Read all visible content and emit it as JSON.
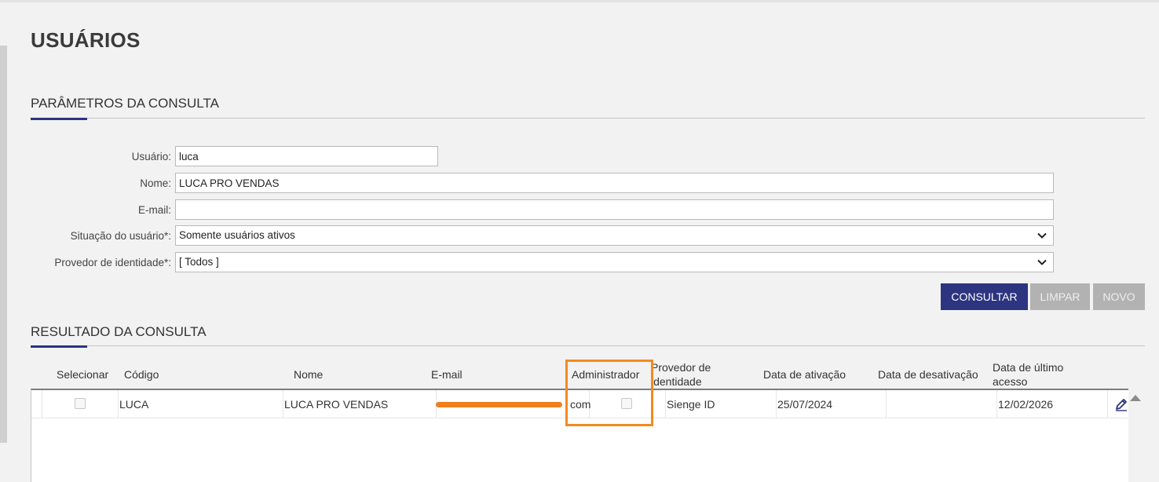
{
  "page": {
    "title": "USUÁRIOS"
  },
  "params": {
    "section_title": "PARÂMETROS DA CONSULTA",
    "fields": {
      "usuario_label": "Usuário:",
      "usuario_value": "luca",
      "nome_label": "Nome:",
      "nome_value": "LUCA PRO VENDAS",
      "email_label": "E-mail:",
      "email_value": "",
      "situacao_label": "Situação do usuário*:",
      "situacao_value": "Somente usuários ativos",
      "provedor_label": "Provedor de identidade*:",
      "provedor_value": "[ Todos ]"
    },
    "buttons": {
      "consultar": "CONSULTAR",
      "limpar": "LIMPAR",
      "novo": "NOVO"
    }
  },
  "results": {
    "section_title": "RESULTADO DA CONSULTA",
    "columns": {
      "selecionar": "Selecionar",
      "codigo": "Código",
      "nome": "Nome",
      "email": "E-mail",
      "administrador": "Administrador",
      "provedor_l1": "Provedor de",
      "provedor_l2": "identidade",
      "data_ativacao": "Data de ativação",
      "data_desativacao": "Data de desativação",
      "ultimo_l1": "Data de último",
      "ultimo_l2": "acesso"
    },
    "rows": [
      {
        "codigo": "LUCA",
        "nome": "LUCA PRO VENDAS",
        "email_suffix": "com",
        "administrador": false,
        "provedor": "Sienge ID",
        "data_ativacao": "25/07/2024",
        "data_desativacao": "",
        "ultimo_acesso": "12/02/2026"
      }
    ]
  },
  "colors": {
    "accent": "#2d3480",
    "highlight": "#f5891f",
    "disabled": "#b2b2b2"
  },
  "icons": {
    "edit": "pencil-icon",
    "select_chevron": "chevron-down-icon",
    "scroll": "scroll-up-arrow-icon"
  }
}
